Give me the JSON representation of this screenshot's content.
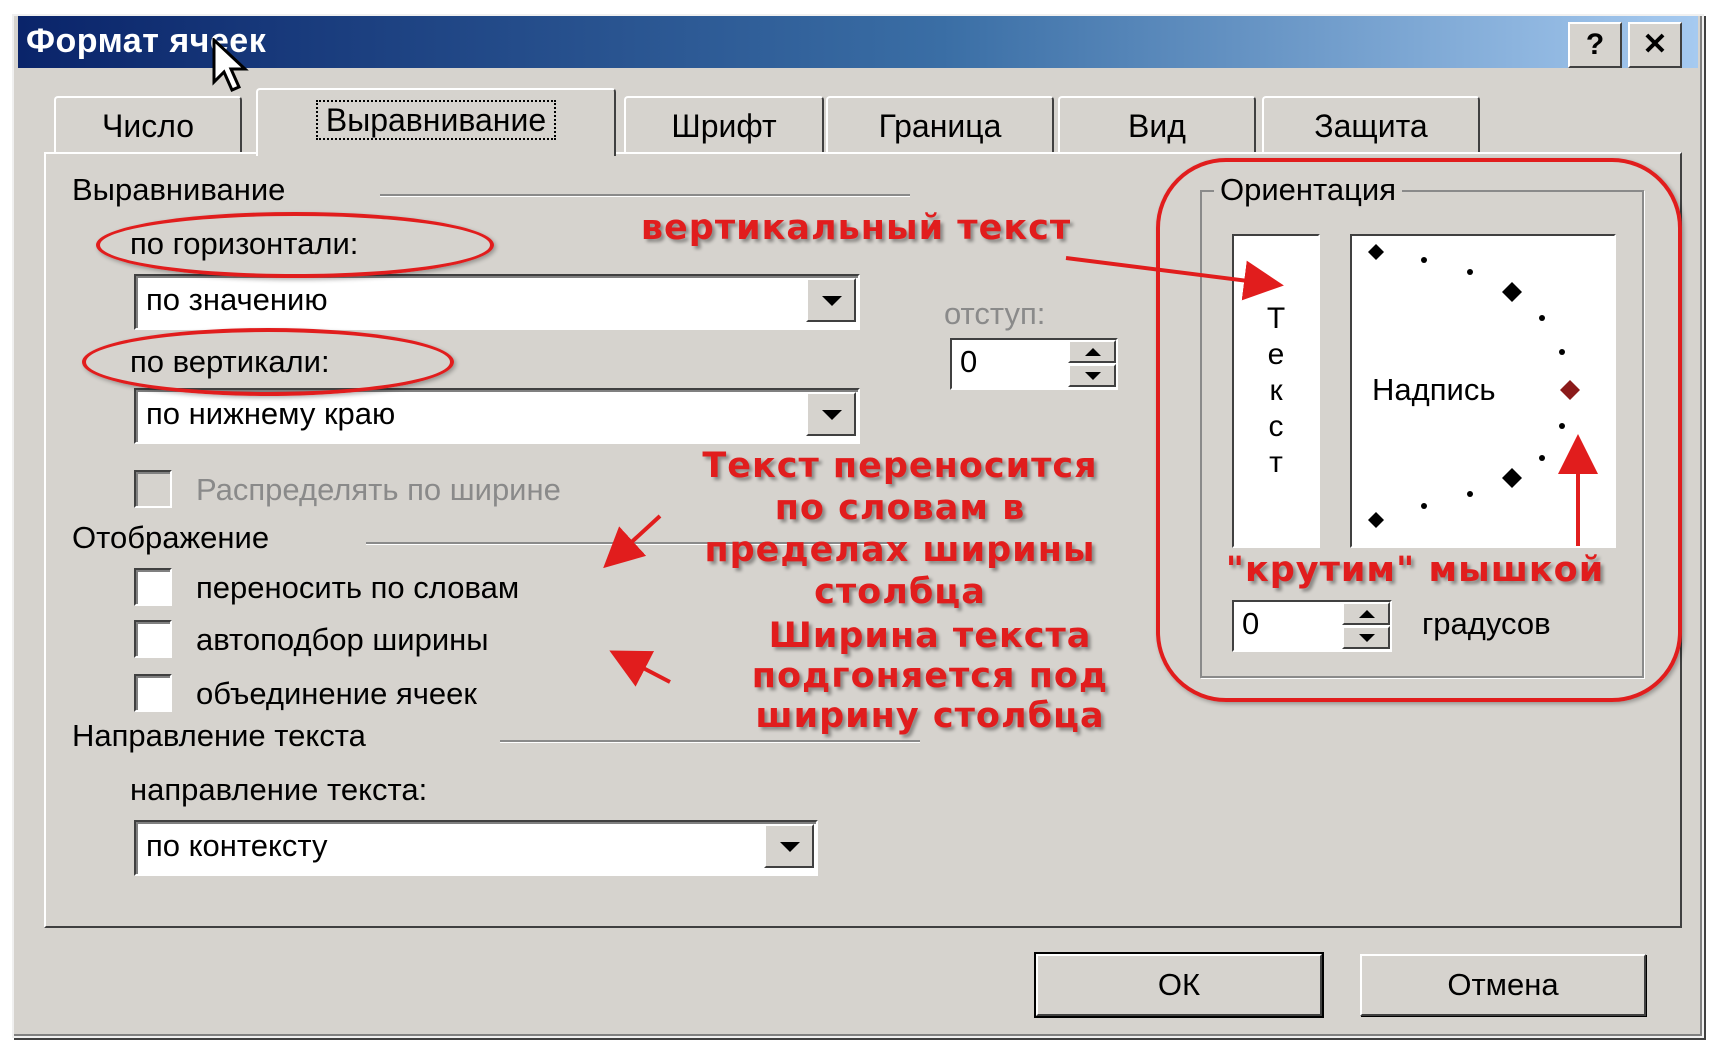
{
  "window": {
    "title": "Формат ячеек",
    "help_label": "?",
    "close_label": "✕"
  },
  "tabs": [
    {
      "label": "Число"
    },
    {
      "label": "Выравнивание"
    },
    {
      "label": "Шрифт"
    },
    {
      "label": "Граница"
    },
    {
      "label": "Вид"
    },
    {
      "label": "Защита"
    }
  ],
  "alignment": {
    "section_title": "Выравнивание",
    "horizontal_label": "по горизонтали:",
    "horizontal_value": "по значению",
    "vertical_label": "по вертикали:",
    "vertical_value": "по нижнему краю",
    "indent_label": "отступ:",
    "indent_value": "0",
    "distribute_label": "Распределять по ширине"
  },
  "display": {
    "section_title": "Отображение",
    "wrap_label": "переносить по словам",
    "autofit_label": "автоподбор ширины",
    "merge_label": "объединение ячеек"
  },
  "direction": {
    "section_title": "Направление текста",
    "field_label": "направление текста:",
    "value": "по контексту"
  },
  "orientation": {
    "title": "Ориентация",
    "vertical_letters": [
      "Т",
      "е",
      "к",
      "с",
      "т"
    ],
    "dial_label": "Надпись",
    "degrees_value": "0",
    "degrees_label": "градусов"
  },
  "buttons": {
    "ok": "ОК",
    "cancel": "Отмена"
  },
  "annotations": {
    "vertical_text": "вертикальный текст",
    "wrap_note": [
      "Текст переносится",
      "по словам в",
      "пределах ширины",
      "столбца"
    ],
    "rotate_note": "\"крутим\" мышкой",
    "autofit_note": [
      "Ширина текста",
      "подгоняется под",
      "ширину столбца"
    ]
  },
  "colors": {
    "annotation": "#e11d1d",
    "title_bar": "#0a246a",
    "dialog_bg": "#d6d3ce"
  }
}
